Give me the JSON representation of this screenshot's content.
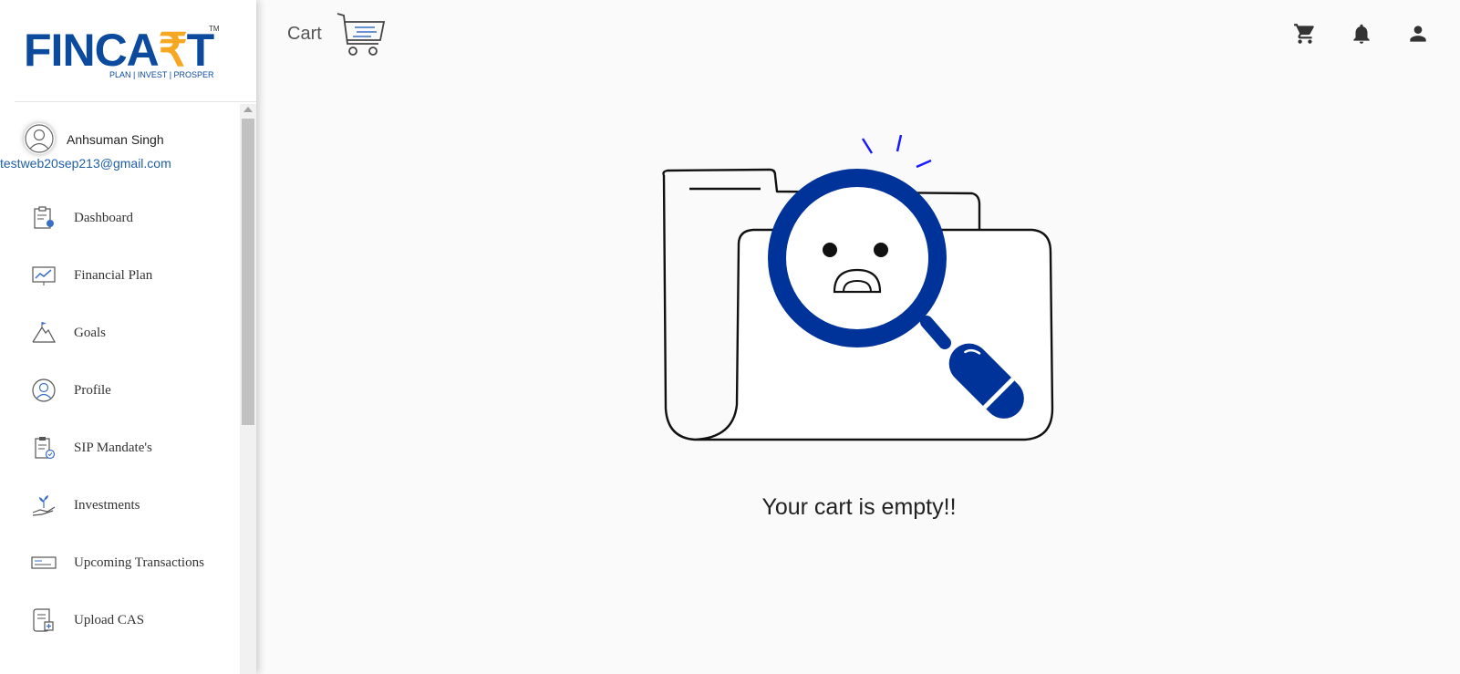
{
  "brand": {
    "logo_text": "FINCA₹T",
    "tagline": "PLAN | INVEST | PROSPER",
    "tm": "TM"
  },
  "user": {
    "name": "Anhsuman Singh",
    "email": "testweb20sep213@gmail.com",
    "avatar_icon": "user-avatar-icon"
  },
  "sidebar": {
    "items": [
      {
        "label": "Dashboard",
        "icon": "dashboard-icon"
      },
      {
        "label": "Financial Plan",
        "icon": "chart-icon"
      },
      {
        "label": "Goals",
        "icon": "mountain-flag-icon"
      },
      {
        "label": "Profile",
        "icon": "profile-icon"
      },
      {
        "label": "SIP Mandate's",
        "icon": "clipboard-check-icon"
      },
      {
        "label": "Investments",
        "icon": "plant-hand-icon"
      },
      {
        "label": "Upcoming Transactions",
        "icon": "cheque-icon"
      },
      {
        "label": "Upload CAS",
        "icon": "document-upload-icon"
      }
    ]
  },
  "header": {
    "title": "Cart",
    "icons": [
      "cart-icon",
      "bell-icon",
      "account-icon"
    ]
  },
  "main": {
    "empty_message": "Your cart is empty!!"
  },
  "colors": {
    "brand_blue": "#003399",
    "brand_orange": "#f7a823",
    "email_blue": "#1f5fa8"
  }
}
